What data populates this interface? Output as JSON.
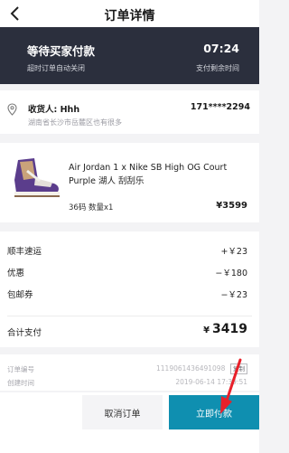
{
  "header": {
    "title": "订单详情",
    "back_icon": "chevron-left-icon"
  },
  "status": {
    "title": "等待买家付款",
    "subtitle": "超时订单自动关闭",
    "timer": "07:24",
    "timer_label": "支付剩余时间"
  },
  "address": {
    "receiver": "收货人: Hhh",
    "phone": "171****2294",
    "text": "湖南省长沙市岳麓区也有很多",
    "icon": "location-pin-icon"
  },
  "product": {
    "title": "Air Jordan 1 x Nike SB High OG Court Purple 湖人 刮刮乐",
    "spec": "36码  数量x1",
    "price": "¥3599"
  },
  "fees": [
    {
      "label": "顺丰速运",
      "value": "+￥23"
    },
    {
      "label": "优惠",
      "value": "−￥180"
    },
    {
      "label": "包邮券",
      "value": "−￥23"
    }
  ],
  "total": {
    "label": "合计支付",
    "currency": "¥",
    "amount": "3419"
  },
  "meta": {
    "order_label": "订单编号",
    "order_no": "1119061436491098",
    "copy_label": "复制",
    "time_label": "创建时间",
    "time_value": "2019-06-14 17:39:51"
  },
  "footer": {
    "cancel_label": "取消订单",
    "pay_label": "立即付款"
  },
  "colors": {
    "status_bg": "#2b2f3d",
    "pay_button": "#0f8fb0",
    "annotation_arrow": "#e8202a"
  }
}
